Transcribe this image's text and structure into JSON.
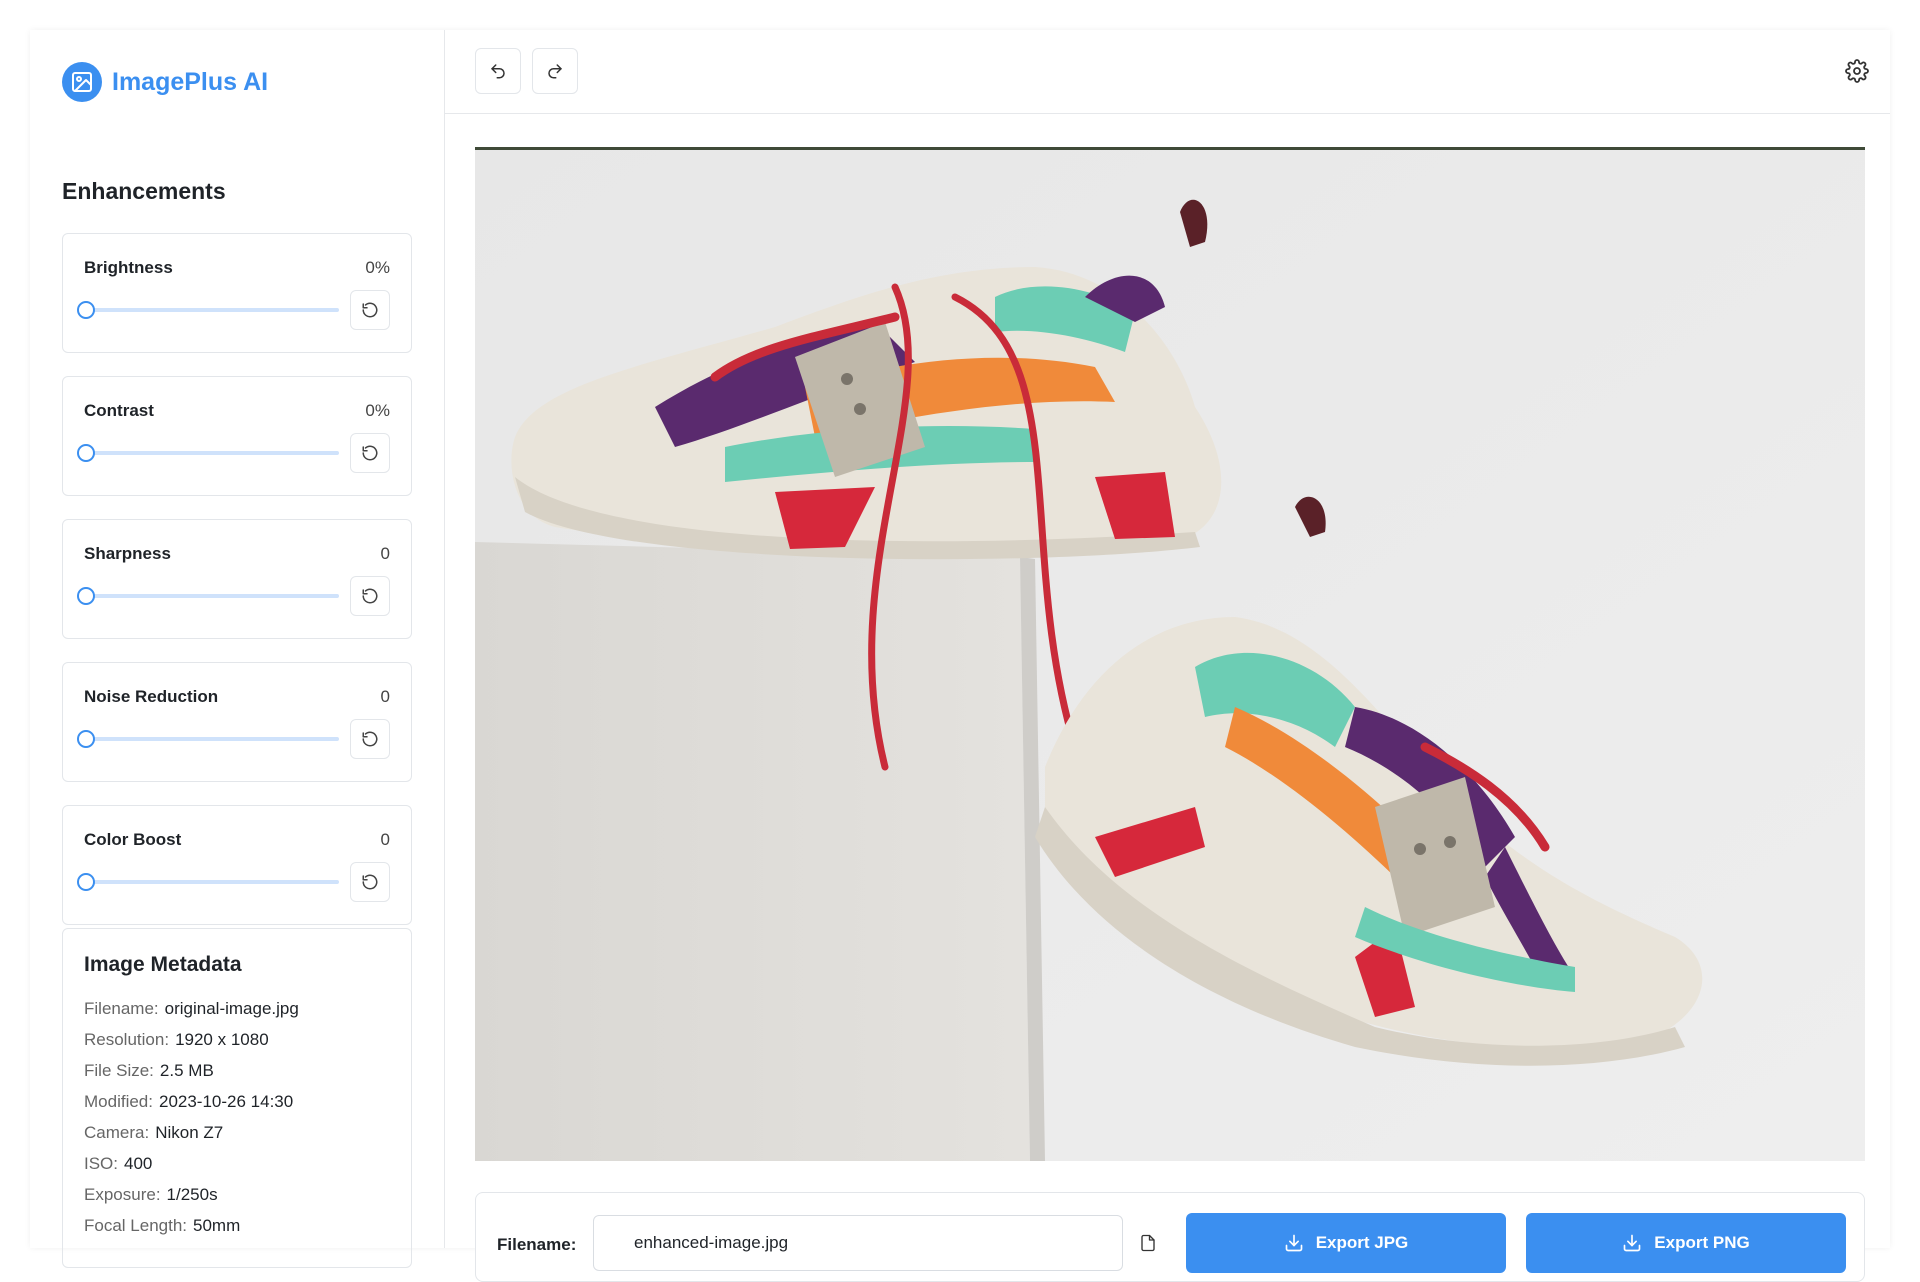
{
  "brand": {
    "name": "ImagePlus AI",
    "logo_icon": "image-icon",
    "color": "#3b8ff0"
  },
  "enhancements": {
    "title": "Enhancements",
    "controls": [
      {
        "label": "Brightness",
        "value": "0%"
      },
      {
        "label": "Contrast",
        "value": "0%"
      },
      {
        "label": "Sharpness",
        "value": "0"
      },
      {
        "label": "Noise Reduction",
        "value": "0"
      },
      {
        "label": "Color Boost",
        "value": "0"
      }
    ]
  },
  "metadata": {
    "title": "Image Metadata",
    "rows": [
      {
        "key": "Filename:",
        "value": "original-image.jpg"
      },
      {
        "key": "Resolution:",
        "value": "1920 x 1080"
      },
      {
        "key": "File Size:",
        "value": "2.5 MB"
      },
      {
        "key": "Modified:",
        "value": "2023-10-26 14:30"
      },
      {
        "key": "Camera:",
        "value": "Nikon Z7"
      },
      {
        "key": "ISO:",
        "value": "400"
      },
      {
        "key": "Exposure:",
        "value": "1/250s"
      },
      {
        "key": "Focal Length:",
        "value": "50mm"
      }
    ]
  },
  "toolbar": {
    "undo_icon": "undo-icon",
    "redo_icon": "redo-icon",
    "settings_icon": "gear-icon"
  },
  "export": {
    "filename_label": "Filename:",
    "filename_value": "enhanced-image.jpg",
    "jpg_label": "Export JPG",
    "png_label": "Export PNG"
  }
}
